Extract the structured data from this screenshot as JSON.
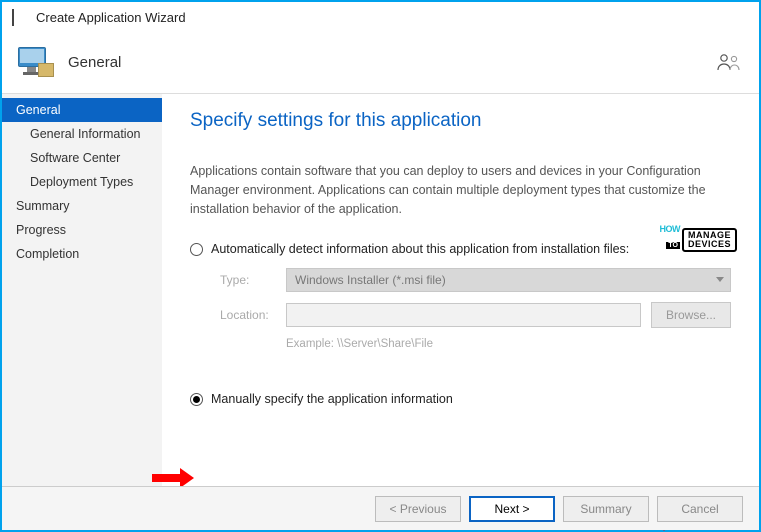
{
  "window": {
    "title": "Create Application Wizard"
  },
  "header": {
    "section": "General"
  },
  "sidebar": {
    "items": [
      {
        "label": "General",
        "selected": true,
        "sub": false
      },
      {
        "label": "General Information",
        "selected": false,
        "sub": true
      },
      {
        "label": "Software Center",
        "selected": false,
        "sub": true
      },
      {
        "label": "Deployment Types",
        "selected": false,
        "sub": true
      },
      {
        "label": "Summary",
        "selected": false,
        "sub": false
      },
      {
        "label": "Progress",
        "selected": false,
        "sub": false
      },
      {
        "label": "Completion",
        "selected": false,
        "sub": false
      }
    ]
  },
  "content": {
    "heading": "Specify settings for this application",
    "description": "Applications contain software that you can deploy to users and devices in your Configuration Manager environment. Applications can contain multiple deployment types that customize the installation behavior of the application.",
    "option_auto": "Automatically detect information about this application from installation files:",
    "option_manual": "Manually specify the application information",
    "form": {
      "type_label": "Type:",
      "type_value": "Windows Installer (*.msi file)",
      "location_label": "Location:",
      "location_value": "",
      "browse": "Browse...",
      "example": "Example: \\\\Server\\Share\\File"
    }
  },
  "watermark": {
    "how": "HOW",
    "to": "TO",
    "line1": "MANAGE",
    "line2": "DEVICES"
  },
  "footer": {
    "previous": "< Previous",
    "next": "Next >",
    "summary": "Summary",
    "cancel": "Cancel"
  }
}
